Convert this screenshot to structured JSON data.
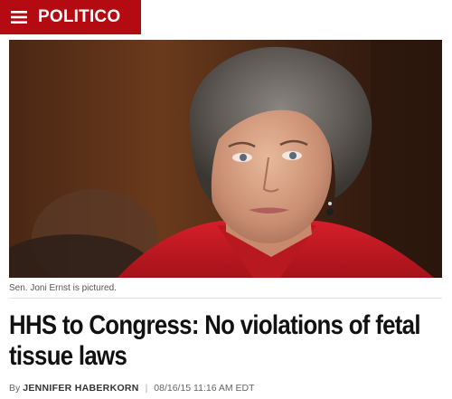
{
  "header": {
    "brand_name": "POLITICO",
    "brand_color": "#b40b12",
    "menu_icon": "hamburger-menu-icon"
  },
  "article": {
    "photo_caption": "Sen. Joni Ernst is pictured.",
    "headline": "HHS to Congress: No violations of fetal tissue laws",
    "byline_prefix": "By",
    "author": "JENNIFER HABERKORN",
    "separator": "|",
    "timestamp": "08/16/15 11:16 AM EDT"
  }
}
